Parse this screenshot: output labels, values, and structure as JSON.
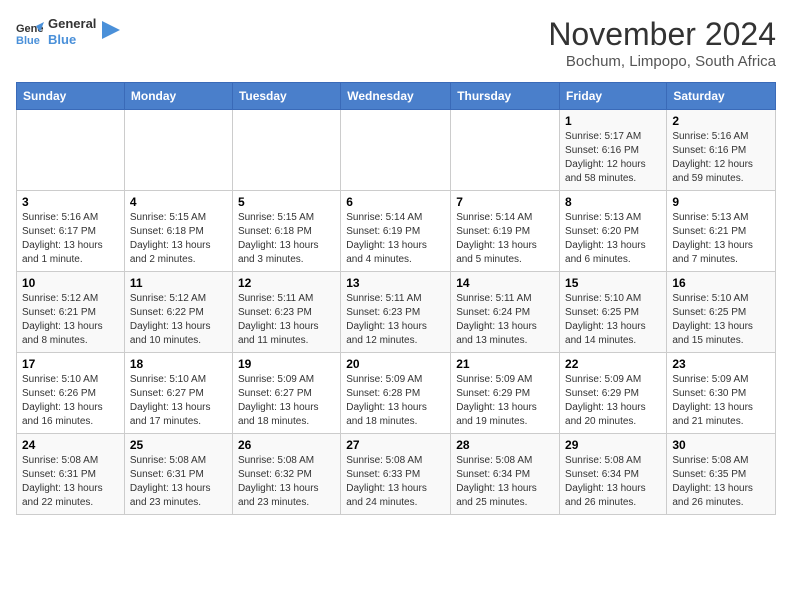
{
  "logo": {
    "line1": "General",
    "line2": "Blue"
  },
  "title": "November 2024",
  "subtitle": "Bochum, Limpopo, South Africa",
  "weekdays": [
    "Sunday",
    "Monday",
    "Tuesday",
    "Wednesday",
    "Thursday",
    "Friday",
    "Saturday"
  ],
  "weeks": [
    [
      {
        "day": "",
        "info": ""
      },
      {
        "day": "",
        "info": ""
      },
      {
        "day": "",
        "info": ""
      },
      {
        "day": "",
        "info": ""
      },
      {
        "day": "",
        "info": ""
      },
      {
        "day": "1",
        "info": "Sunrise: 5:17 AM\nSunset: 6:16 PM\nDaylight: 12 hours and 58 minutes."
      },
      {
        "day": "2",
        "info": "Sunrise: 5:16 AM\nSunset: 6:16 PM\nDaylight: 12 hours and 59 minutes."
      }
    ],
    [
      {
        "day": "3",
        "info": "Sunrise: 5:16 AM\nSunset: 6:17 PM\nDaylight: 13 hours and 1 minute."
      },
      {
        "day": "4",
        "info": "Sunrise: 5:15 AM\nSunset: 6:18 PM\nDaylight: 13 hours and 2 minutes."
      },
      {
        "day": "5",
        "info": "Sunrise: 5:15 AM\nSunset: 6:18 PM\nDaylight: 13 hours and 3 minutes."
      },
      {
        "day": "6",
        "info": "Sunrise: 5:14 AM\nSunset: 6:19 PM\nDaylight: 13 hours and 4 minutes."
      },
      {
        "day": "7",
        "info": "Sunrise: 5:14 AM\nSunset: 6:19 PM\nDaylight: 13 hours and 5 minutes."
      },
      {
        "day": "8",
        "info": "Sunrise: 5:13 AM\nSunset: 6:20 PM\nDaylight: 13 hours and 6 minutes."
      },
      {
        "day": "9",
        "info": "Sunrise: 5:13 AM\nSunset: 6:21 PM\nDaylight: 13 hours and 7 minutes."
      }
    ],
    [
      {
        "day": "10",
        "info": "Sunrise: 5:12 AM\nSunset: 6:21 PM\nDaylight: 13 hours and 8 minutes."
      },
      {
        "day": "11",
        "info": "Sunrise: 5:12 AM\nSunset: 6:22 PM\nDaylight: 13 hours and 10 minutes."
      },
      {
        "day": "12",
        "info": "Sunrise: 5:11 AM\nSunset: 6:23 PM\nDaylight: 13 hours and 11 minutes."
      },
      {
        "day": "13",
        "info": "Sunrise: 5:11 AM\nSunset: 6:23 PM\nDaylight: 13 hours and 12 minutes."
      },
      {
        "day": "14",
        "info": "Sunrise: 5:11 AM\nSunset: 6:24 PM\nDaylight: 13 hours and 13 minutes."
      },
      {
        "day": "15",
        "info": "Sunrise: 5:10 AM\nSunset: 6:25 PM\nDaylight: 13 hours and 14 minutes."
      },
      {
        "day": "16",
        "info": "Sunrise: 5:10 AM\nSunset: 6:25 PM\nDaylight: 13 hours and 15 minutes."
      }
    ],
    [
      {
        "day": "17",
        "info": "Sunrise: 5:10 AM\nSunset: 6:26 PM\nDaylight: 13 hours and 16 minutes."
      },
      {
        "day": "18",
        "info": "Sunrise: 5:10 AM\nSunset: 6:27 PM\nDaylight: 13 hours and 17 minutes."
      },
      {
        "day": "19",
        "info": "Sunrise: 5:09 AM\nSunset: 6:27 PM\nDaylight: 13 hours and 18 minutes."
      },
      {
        "day": "20",
        "info": "Sunrise: 5:09 AM\nSunset: 6:28 PM\nDaylight: 13 hours and 18 minutes."
      },
      {
        "day": "21",
        "info": "Sunrise: 5:09 AM\nSunset: 6:29 PM\nDaylight: 13 hours and 19 minutes."
      },
      {
        "day": "22",
        "info": "Sunrise: 5:09 AM\nSunset: 6:29 PM\nDaylight: 13 hours and 20 minutes."
      },
      {
        "day": "23",
        "info": "Sunrise: 5:09 AM\nSunset: 6:30 PM\nDaylight: 13 hours and 21 minutes."
      }
    ],
    [
      {
        "day": "24",
        "info": "Sunrise: 5:08 AM\nSunset: 6:31 PM\nDaylight: 13 hours and 22 minutes."
      },
      {
        "day": "25",
        "info": "Sunrise: 5:08 AM\nSunset: 6:31 PM\nDaylight: 13 hours and 23 minutes."
      },
      {
        "day": "26",
        "info": "Sunrise: 5:08 AM\nSunset: 6:32 PM\nDaylight: 13 hours and 23 minutes."
      },
      {
        "day": "27",
        "info": "Sunrise: 5:08 AM\nSunset: 6:33 PM\nDaylight: 13 hours and 24 minutes."
      },
      {
        "day": "28",
        "info": "Sunrise: 5:08 AM\nSunset: 6:34 PM\nDaylight: 13 hours and 25 minutes."
      },
      {
        "day": "29",
        "info": "Sunrise: 5:08 AM\nSunset: 6:34 PM\nDaylight: 13 hours and 26 minutes."
      },
      {
        "day": "30",
        "info": "Sunrise: 5:08 AM\nSunset: 6:35 PM\nDaylight: 13 hours and 26 minutes."
      }
    ]
  ]
}
